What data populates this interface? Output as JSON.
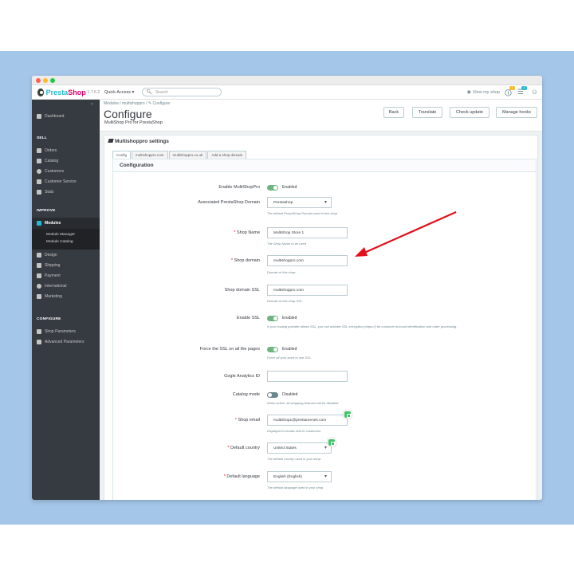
{
  "app": {
    "logo_text_a": "Presta",
    "logo_text_b": "Shop",
    "version": "1.7.6.2",
    "quick_access": "Quick Access ▾",
    "search_placeholder": "Search",
    "view_shop": "View my shop",
    "notif_count_1": "1",
    "notif_count_2": "2"
  },
  "sidebar": {
    "collapse": "«",
    "dashboard": "Dashboard",
    "sections": {
      "sell": "SELL",
      "improve": "IMPROVE",
      "configure": "CONFIGURE"
    },
    "sell_items": [
      "Orders",
      "Catalog",
      "Customers",
      "Customer Service",
      "Stats"
    ],
    "modules": "Modules",
    "module_sub": [
      "Module Manager",
      "Module Catalog"
    ],
    "improve_items": [
      "Design",
      "Shipping",
      "Payment",
      "International",
      "Marketing"
    ],
    "configure_items": [
      "Shop Parameters",
      "Advanced Parameters"
    ]
  },
  "header": {
    "breadcrumb": "Modules  /  multishoppro  /  ✎ Configure",
    "title": "Configure",
    "subtitle": "MultiShop Pro for PrestaShop",
    "buttons": [
      "Back",
      "Translate",
      "Check update",
      "Manage hooks"
    ]
  },
  "panel": {
    "title": "Multishoppro settings",
    "tabs": [
      "Config",
      "multishoppro.com",
      "multishoppro.co.uk",
      "Add a shop domain"
    ],
    "section_title": "Configuration"
  },
  "form": {
    "enable_multishop": {
      "label": "Enable MultiShopPro",
      "state": "Enabled"
    },
    "associated_domain": {
      "label": "Associated PrestaShop Domain",
      "value": "Prestashop",
      "help": "The default PrestaShop Domain used in this shop"
    },
    "shop_name": {
      "label": "Shop Name",
      "value": "MultiShop Store 1",
      "help": "The Shop Name to be used"
    },
    "shop_domain": {
      "label": "Shop domain",
      "value": "multishoppro.com",
      "help": "Domain of this shop."
    },
    "shop_domain_ssl": {
      "label": "Shop domain SSL",
      "value": "multishoppro.com",
      "help": "Domain of this shop SSL."
    },
    "enable_ssl": {
      "label": "Enable SSL",
      "state": "Enabled",
      "help": "If your hosting provider allows SSL, you can activate SSL encryption (https://) for customer account identification and order processing."
    },
    "force_ssl": {
      "label": "Force the SSL on all the pages",
      "state": "Enabled",
      "help": "Force all your store to use SSL."
    },
    "analytics": {
      "label": "Gogle Analytics ID",
      "value": ""
    },
    "catalog_mode": {
      "label": "Catalog mode",
      "state": "Disabled",
      "help": "When active, all shopping features will be disabled"
    },
    "shop_email": {
      "label": "Shop email",
      "value": "multishop1@prestamenes.com",
      "help": "Displayed in emails sent to customers"
    },
    "default_country": {
      "label": "Default country",
      "value": "United States",
      "help": "The default country used in your shop."
    },
    "default_language": {
      "label": "Default language",
      "value": "English (English)",
      "help": "The default language used in your shop."
    }
  },
  "colors": {
    "accent": "#25b9d7",
    "toggle_on": "#70b580",
    "toggle_off": "#6c868e",
    "arrow": "#e3101a",
    "sidebar": "#363a41"
  }
}
